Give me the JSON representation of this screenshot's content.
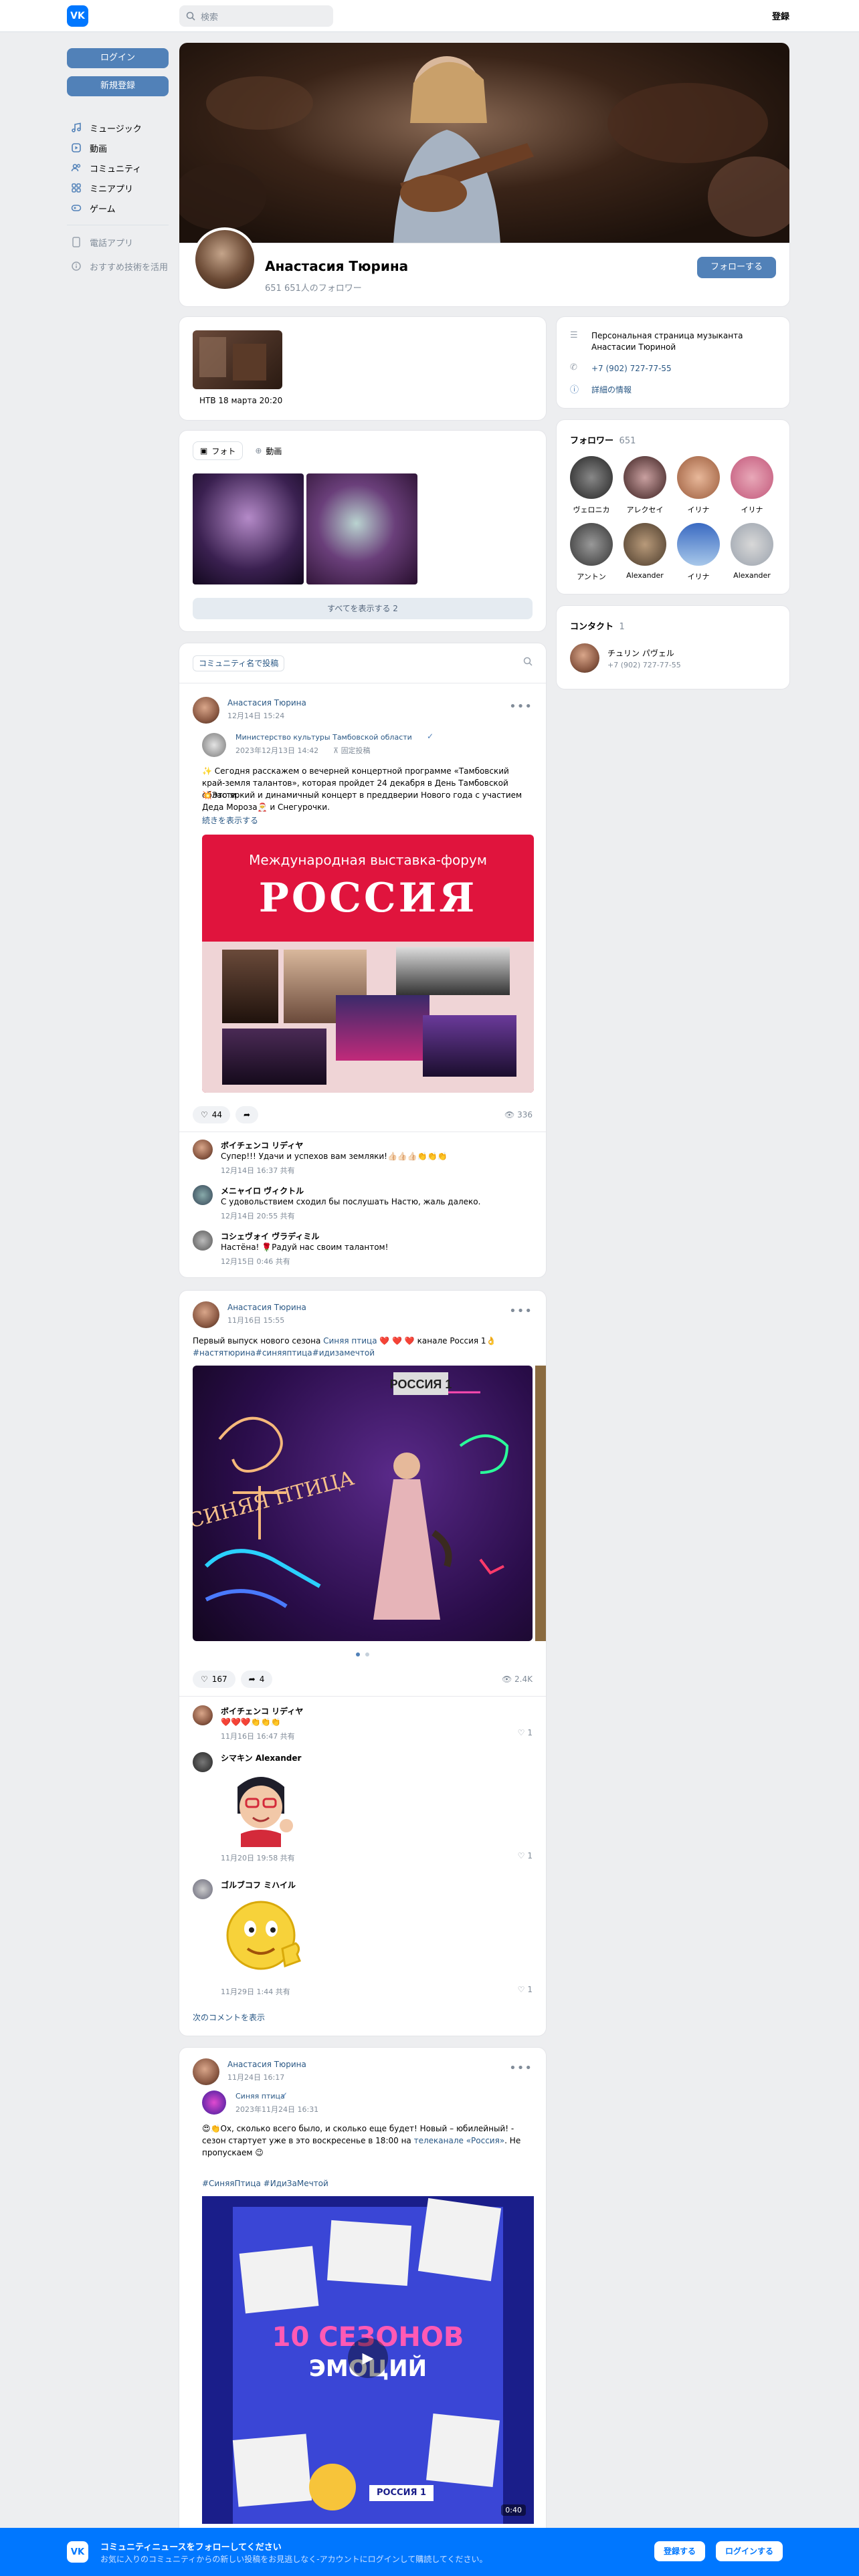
{
  "topbar": {
    "logo": "VK",
    "search_placeholder": "検索",
    "register": "登録"
  },
  "leftnav": {
    "login": "ログイン",
    "signup": "新規登録",
    "items": [
      {
        "label": "ミュージック",
        "icon": "music-icon"
      },
      {
        "label": "動画",
        "icon": "video-icon"
      },
      {
        "label": "コミュニティ",
        "icon": "community-icon"
      },
      {
        "label": "ミニアプリ",
        "icon": "apps-icon"
      },
      {
        "label": "ゲーム",
        "icon": "game-icon"
      }
    ],
    "phone_app": "電話アプリ",
    "about": "おすすめ技術を活用"
  },
  "profile": {
    "name": "Анастасия Тюрина",
    "followers": "651 651人のフォロワー",
    "follow_btn": "フォローする"
  },
  "video_card": {
    "caption": "НТВ 18 марта 20:20"
  },
  "photos_card": {
    "tab_photo": "フォト",
    "tab_video": "動画",
    "show_all": "すべてを表示する 2"
  },
  "feed": {
    "search_label": "コミュニティ名で投稿"
  },
  "post1": {
    "author": "Анастасия Тюрина",
    "date": "12月14日 15:24",
    "repost_author": "Министерство культуры Тамбовской области",
    "repost_date": "2023年12月13日 14:42",
    "repost_badge": "固定投稿",
    "text1": "✨ Сегодня расскажем о вечерней концертной программе «Тамбовский край-земля талантов», которая пройдет 24 декабря в День Тамбовской области.",
    "text2": "💥Это яркий и динамичный концерт в преддверии Нового года с участием Деда Мороза🎅 и Снегурочки.",
    "more": "続きを表示する",
    "banner_top": "Международная выставка-форум",
    "banner_title": "РОССИЯ",
    "likes": "44",
    "views": "336",
    "comments": [
      {
        "name": "ボイチェンコ リディヤ",
        "text": "Супер!!! Удачи и успехов вам земляки!👍🏻👍🏻👍🏻👏👏👏",
        "meta": "12月14日 16:37  共有"
      },
      {
        "name": "メニャイロ ヴィクトル",
        "text": "С удовольствием сходил бы послушать Настю, жаль далеко.",
        "meta": "12月14日 20:55  共有"
      },
      {
        "name": "コシェヴォイ ヴラディミル",
        "text": "Настёна! 🌹Радуй нас своим талантом!",
        "meta": "12月15日 0:46  共有"
      }
    ]
  },
  "post2": {
    "author": "Анастасия Тюрина",
    "date": "11月16日 15:55",
    "text_a": "Первый выпуск нового сезона ",
    "text_link": "Синяя птица",
    "text_b": " ❤️ ❤️ ❤️ канале Россия 1👌",
    "tags": "#настятюрина#синяяптица#идизамечтой",
    "sign_logo": "РОССИЯ 1",
    "sign_text": "СИНЯЯ ПТИЦА",
    "likes": "167",
    "shares": "4",
    "views": "2.4K",
    "comments": [
      {
        "name": "ボイチェンコ リディヤ",
        "text": "❤️❤️❤️👏👏👏",
        "meta": "11月16日 16:47  共有",
        "likes": "1"
      },
      {
        "name": "シマキン Alexander",
        "text": "",
        "meta": "11月20日 19:58  共有",
        "likes": "1"
      },
      {
        "name": "ゴルブコフ ミハイル",
        "text": "",
        "meta": "11月29日 1:44  共有",
        "likes": "1"
      }
    ],
    "next_comments": "次のコメントを表示"
  },
  "post3": {
    "author": "Анастасия Тюрина",
    "date": "11月24日 16:17",
    "repost_author": "Синяя птица",
    "repost_date": "2023年11月24日 16:31",
    "text_a": "😍👏Ох, сколько всего было, и сколько еще будет! Новый – юбилейный! - сезон стартует уже в это воскресенье в 18:00 на ",
    "text_link": "телеканале «Россия»",
    "text_b": ". Не пропускаем 😉",
    "tags": "#СиняяПтица #ИдиЗаМечтой",
    "video_title1": "10 СЕЗОНОВ",
    "video_title2": "ЭМОЦИЙ",
    "video_logo": "РОССИЯ 1",
    "video_duration": "0:40"
  },
  "right": {
    "about": "Персональная страница музыканта Анастасии Тюриной",
    "phone": "+7 (902) 727-77-55",
    "details": "詳細の情報",
    "followers_title": "フォロワー",
    "followers_count": "651",
    "followers": [
      "ヴェロニカ",
      "アレクセイ",
      "イリナ",
      "イリナ",
      "アントン",
      "Alexander",
      "イリナ",
      "Alexander"
    ],
    "contacts_title": "コンタクト",
    "contacts_count": "1",
    "contact_name": "チュリン パヴェル",
    "contact_phone": "+7 (902) 727-77-55"
  },
  "bottombar": {
    "title": "コミュニティニュースをフォローしてください",
    "sub": "お気に入りのコミュニティからの新しい投稿をお見逃しなく-アカウントにログインして購読してください。",
    "register": "登録する",
    "login": "ログインする"
  }
}
